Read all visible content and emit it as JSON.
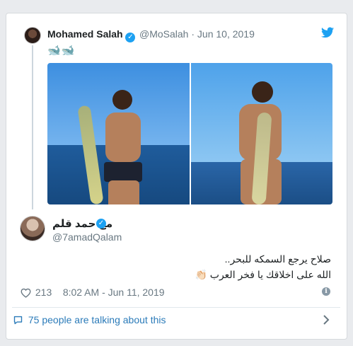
{
  "quoted": {
    "name": "Mohamed Salah",
    "verified_mark": "✓",
    "handle": "@MoSalah",
    "separator": "·",
    "date": "Jun 10, 2019",
    "text_emoji": "🐋🐋"
  },
  "main": {
    "name": "مع حمد قلم",
    "verified_mark": "✓",
    "handle": "@7amadQalam",
    "text_line_1": "صلاح يرجع السمكه للبحر..",
    "text_line_2": "الله على اخلاقك يا فخر العرب",
    "clap_emoji": "👏🏻",
    "likes": "213",
    "time": "8:02 AM - Jun 11, 2019",
    "info_mark": "i"
  },
  "footer": {
    "talking_text": "75 people are talking about this"
  },
  "colors": {
    "accent": "#1da1f2",
    "link": "#2b7bb9",
    "muted": "#697882"
  }
}
